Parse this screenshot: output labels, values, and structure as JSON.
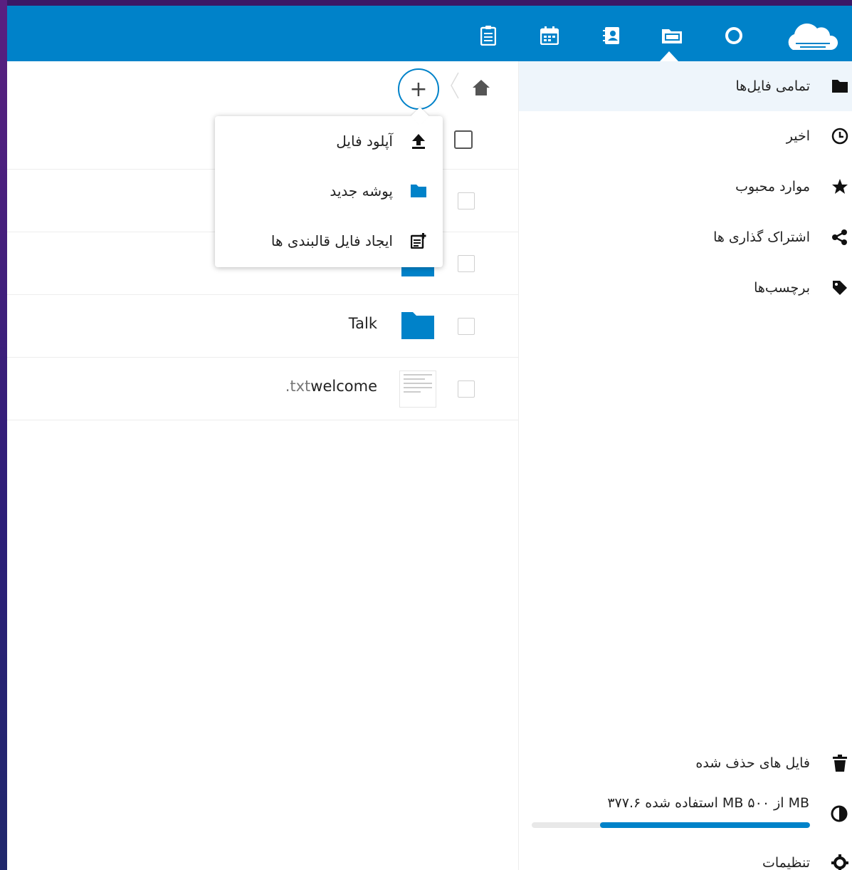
{
  "header": {
    "apps": [
      {
        "name": "tasks-icon"
      },
      {
        "name": "calendar-icon"
      },
      {
        "name": "contacts-icon"
      },
      {
        "name": "files-icon",
        "active": true
      },
      {
        "name": "activity-icon"
      }
    ],
    "logo": "nextcloud-logo"
  },
  "sidebar": {
    "items": [
      {
        "label": "تمامی فایل‌ها",
        "icon": "folder-icon",
        "active": true
      },
      {
        "label": "اخیر",
        "icon": "clock-icon"
      },
      {
        "label": "موارد محبوب",
        "icon": "star-icon"
      },
      {
        "label": "اشتراک گذاری ها",
        "icon": "share-icon"
      },
      {
        "label": "برچسب‌ها",
        "icon": "tag-icon"
      }
    ],
    "deleted_files": "فایل های حذف شده",
    "quota": {
      "text": "استفاده شده ۳۷۷.۶ MB از ۵۰۰ MB",
      "fraction": 0.755
    },
    "settings": "تنظیمات"
  },
  "breadcrumb": {
    "home": "home-icon",
    "add": "+"
  },
  "new_menu": {
    "items": [
      {
        "label": "آپلود فایل",
        "icon": "upload-icon"
      },
      {
        "label": "پوشه جدید",
        "icon": "new-folder-icon"
      },
      {
        "label": "ایجاد فایل قالبندی ها",
        "icon": "new-template-icon"
      }
    ]
  },
  "files": [
    {
      "name": "",
      "type": "folder"
    },
    {
      "name": "...",
      "type": "folder"
    },
    {
      "name": "Talk",
      "type": "folder"
    },
    {
      "name": "welcome",
      "ext": ".txt",
      "type": "text"
    }
  ],
  "colors": {
    "primary": "#0082c9",
    "active_bg": "#eef5fb"
  }
}
